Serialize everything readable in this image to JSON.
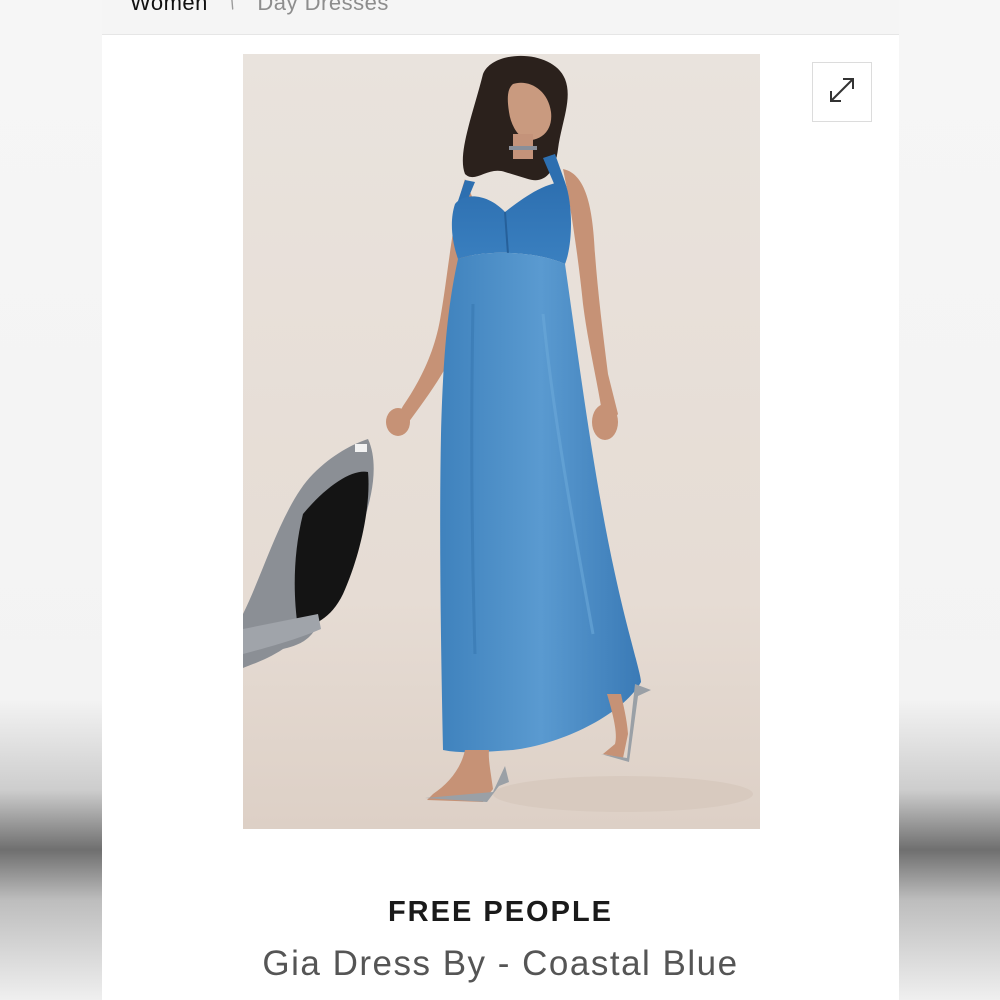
{
  "breadcrumb": {
    "items": [
      "Women",
      "Day Dresses"
    ],
    "separator": "›"
  },
  "product": {
    "image_alt": "Model wearing blue satin maxi dress",
    "brand": "FREE PEOPLE",
    "title": "Gia Dress By - Coastal Blue"
  },
  "icons": {
    "expand": "expand-diagonal-arrows-icon"
  },
  "colors": {
    "dress": "#4f8fc4",
    "bodice": "#2f73b4",
    "backdrop": "#e7dfd8"
  }
}
